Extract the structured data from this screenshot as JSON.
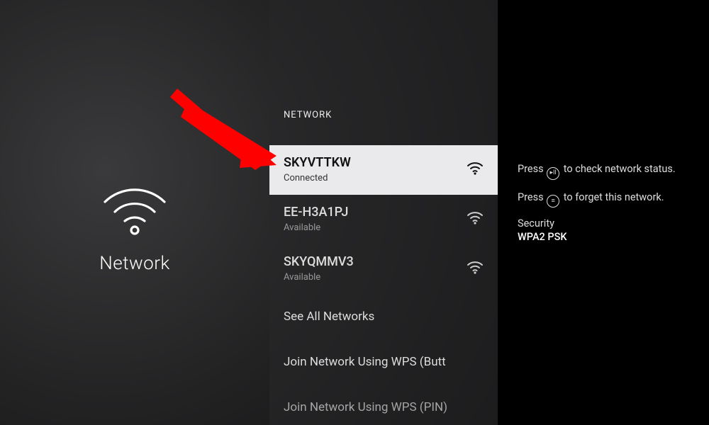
{
  "left": {
    "title": "Network"
  },
  "mid": {
    "header": "NETWORK",
    "networks": [
      {
        "name": "SKYVTTKW",
        "status": "Connected"
      },
      {
        "name": "EE-H3A1PJ",
        "status": "Available"
      },
      {
        "name": "SKYQMMV3",
        "status": "Available"
      }
    ],
    "see_all": "See All Networks",
    "wps_button": "Join Network Using WPS (Butt",
    "wps_pin": "Join Network Using WPS (PIN)"
  },
  "right": {
    "tip1_prefix": "Press ",
    "tip1_icon": "▸II",
    "tip1_suffix": " to check network status.",
    "tip2_prefix": "Press ",
    "tip2_icon": "≡",
    "tip2_suffix": " to forget this network.",
    "security_label": "Security",
    "security_value": "WPA2 PSK"
  }
}
